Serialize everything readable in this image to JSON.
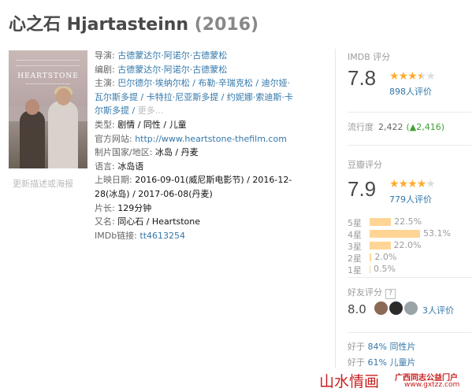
{
  "title": {
    "name": "心之石 Hjartasteinn",
    "year": "(2016)"
  },
  "poster": {
    "title_text": "HEARTSTONE",
    "update_link": "更新描述或海报"
  },
  "info": [
    {
      "label": "导演: ",
      "value": "古德蒙达尔·阿诺尔·古德蒙松",
      "link": true
    },
    {
      "label": "编剧: ",
      "value": "古德蒙达尔·阿诺尔·古德蒙松",
      "link": true
    },
    {
      "label": "主演: ",
      "value": "巴尔德尔·埃纳尔松 / 布勒·辛瑞克松 / 迪尔娅·瓦尔斯多提 / 卡特拉·尼亚斯多提 / 约妮娜·索迪斯·卡尔斯多提 / ",
      "link": true,
      "more": "更多..."
    },
    {
      "label": "类型: ",
      "value": "剧情 / 同性 / 儿童",
      "link": false
    },
    {
      "label": "官方网站: ",
      "value": "http://www.heartstone-thefilm.com",
      "link": true
    },
    {
      "label": "制片国家/地区: ",
      "value": "冰岛 / 丹麦",
      "link": false
    },
    {
      "label": "语言: ",
      "value": "冰岛语",
      "link": false
    },
    {
      "label": "上映日期: ",
      "value": "2016-09-01(威尼斯电影节) / 2016-12-28(冰岛) / 2017-06-08(丹麦)",
      "link": false
    },
    {
      "label": "片长: ",
      "value": "129分钟",
      "link": false
    },
    {
      "label": "又名: ",
      "value": "同心石 / Heartstone",
      "link": false
    },
    {
      "label": "IMDb链接: ",
      "value": "tt4613254",
      "link": true
    }
  ],
  "imdb": {
    "label": "IMDB 评分",
    "score": "7.8",
    "stars": 3.5,
    "votes": "898人评价"
  },
  "trend": {
    "label": "流行度",
    "value": "2,422",
    "change": "(▲2,416)"
  },
  "douban": {
    "label": "豆瓣评分",
    "score": "7.9",
    "stars": 4,
    "votes": "779人评价"
  },
  "distribution": [
    {
      "star": "5星",
      "pct": 22.5,
      "label": "22.5%"
    },
    {
      "star": "4星",
      "pct": 53.1,
      "label": "53.1%"
    },
    {
      "star": "3星",
      "pct": 22.0,
      "label": "22.0%"
    },
    {
      "star": "2星",
      "pct": 2.0,
      "label": "2.0%"
    },
    {
      "star": "1星",
      "pct": 0.5,
      "label": "0.5%"
    }
  ],
  "friends": {
    "label": "好友评分",
    "help": "?",
    "score": "8.0",
    "count": "3人评价",
    "avatar_colors": [
      "#8a6a55",
      "#2b2b2b",
      "#9aa3a8"
    ]
  },
  "better_than": [
    {
      "prefix": "好于 ",
      "pct": "84%",
      "genre": "同性片"
    },
    {
      "prefix": "好于 ",
      "pct": "61%",
      "genre": "儿童片"
    }
  ],
  "watermark": {
    "text": "山水情画",
    "site": "广西同志公益门户",
    "url": "www.gxtzz.com"
  },
  "colors": {
    "link": "#3377aa",
    "star": "#ffac2d",
    "bar": "#ffd596",
    "watermark": "#c81e1e"
  }
}
